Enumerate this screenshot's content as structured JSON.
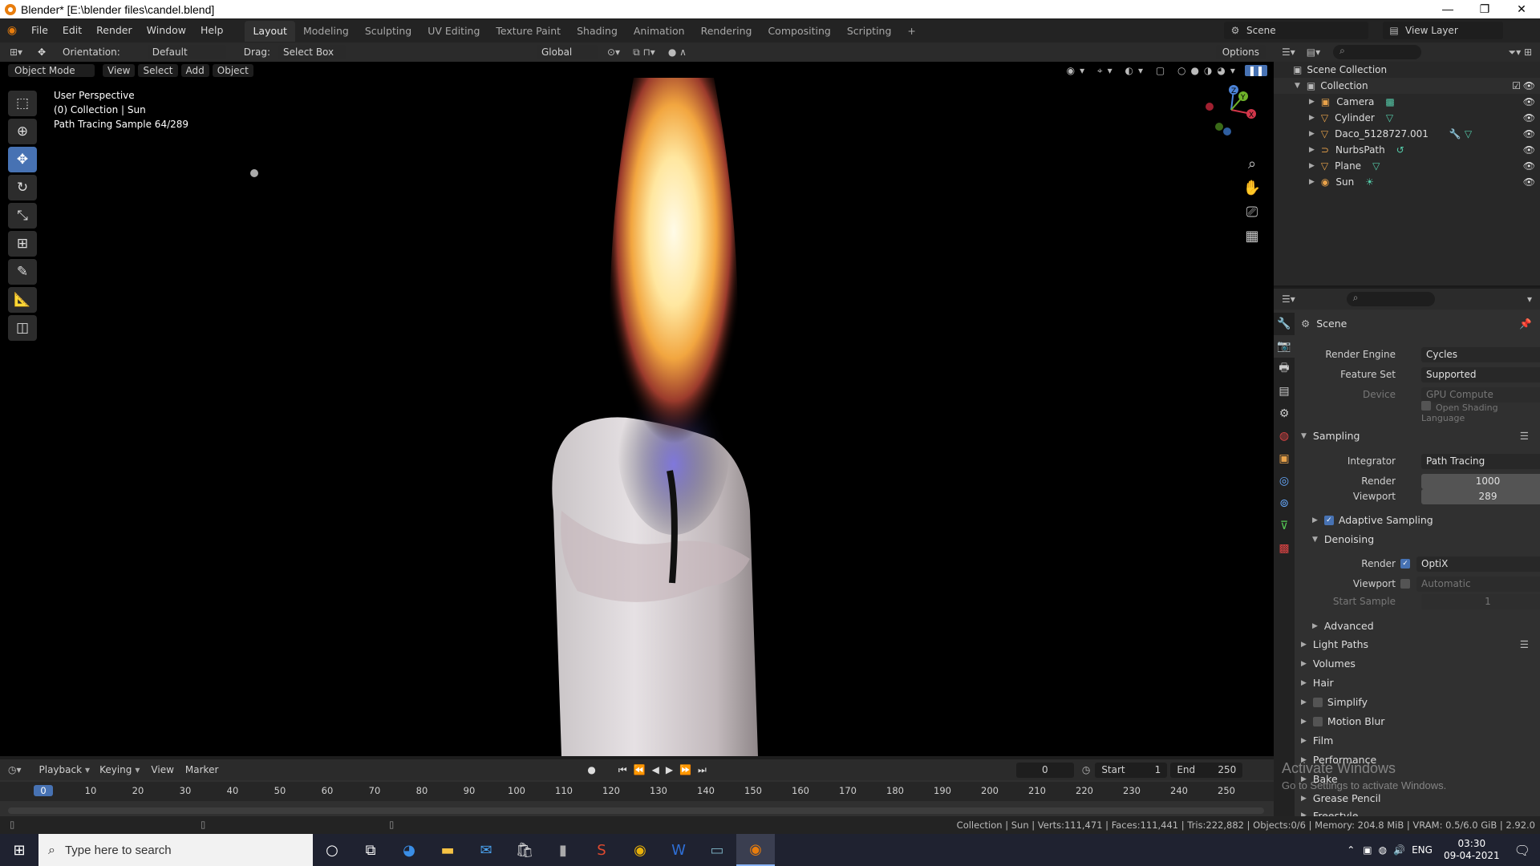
{
  "window": {
    "title": "Blender* [E:\\blender files\\candel.blend]",
    "min": "—",
    "max": "❐",
    "close": "✕"
  },
  "menu": [
    "File",
    "Edit",
    "Render",
    "Window",
    "Help"
  ],
  "workspaces": [
    "Layout",
    "Modeling",
    "Sculpting",
    "UV Editing",
    "Texture Paint",
    "Shading",
    "Animation",
    "Rendering",
    "Compositing",
    "Scripting"
  ],
  "active_workspace": "Layout",
  "scene": {
    "label": "Scene",
    "view_layer": "View Layer"
  },
  "tool_header": {
    "orientation_label": "Orientation:",
    "orientation_value": "Default",
    "drag_label": "Drag:",
    "drag_value": "Select Box",
    "transform": "Global",
    "options": "Options"
  },
  "viewport_header": {
    "mode": "Object Mode",
    "menus": [
      "View",
      "Select",
      "Add",
      "Object"
    ]
  },
  "viewport_info": {
    "line1": "User Perspective",
    "line2": "(0) Collection | Sun",
    "line3": "Path Tracing Sample 64/289"
  },
  "gizmo": {
    "x": "X",
    "y": "Y",
    "z": "Z"
  },
  "outliner": {
    "root": "Scene Collection",
    "collection": "Collection",
    "items": [
      {
        "name": "Camera",
        "icon": "camera-icon",
        "color": "#e8a24a"
      },
      {
        "name": "Cylinder",
        "icon": "mesh-icon",
        "color": "#e8a24a"
      },
      {
        "name": "Daco_5128727.001",
        "icon": "mesh-icon",
        "color": "#e8a24a"
      },
      {
        "name": "NurbsPath",
        "icon": "curve-icon",
        "color": "#e8a24a"
      },
      {
        "name": "Plane",
        "icon": "mesh-icon",
        "color": "#e8a24a"
      },
      {
        "name": "Sun",
        "icon": "light-icon",
        "color": "#e8a24a"
      }
    ]
  },
  "properties": {
    "context": "Scene",
    "render_engine_label": "Render Engine",
    "render_engine": "Cycles",
    "feature_set_label": "Feature Set",
    "feature_set": "Supported",
    "device_label": "Device",
    "device": "GPU Compute",
    "osl": "Open Shading Language",
    "sampling": "Sampling",
    "integrator_label": "Integrator",
    "integrator": "Path Tracing",
    "render_label": "Render",
    "render_samples": "1000",
    "viewport_label": "Viewport",
    "viewport_samples": "289",
    "adaptive": "Adaptive Sampling",
    "denoising": "Denoising",
    "den_render_label": "Render",
    "den_render": "OptiX",
    "den_viewport_label": "Viewport",
    "den_viewport": "Automatic",
    "start_sample_label": "Start Sample",
    "start_sample": "1",
    "advanced": "Advanced",
    "sections": [
      "Light Paths",
      "Volumes",
      "Hair",
      "Simplify",
      "Motion Blur",
      "Film",
      "Performance",
      "Bake",
      "Grease Pencil",
      "Freestyle"
    ]
  },
  "timeline": {
    "menus": [
      "Playback",
      "Keying",
      "View",
      "Marker"
    ],
    "current": "0",
    "start_label": "Start",
    "start": "1",
    "end_label": "End",
    "end": "250",
    "ticks": [
      "0",
      "10",
      "20",
      "30",
      "40",
      "50",
      "60",
      "70",
      "80",
      "90",
      "100",
      "110",
      "120",
      "130",
      "140",
      "150",
      "160",
      "170",
      "180",
      "190",
      "200",
      "210",
      "220",
      "230",
      "240",
      "250"
    ]
  },
  "watermark": {
    "line1": "Activate Windows",
    "line2": "Go to Settings to activate Windows."
  },
  "status": "Collection | Sun | Verts:111,471 | Faces:111,441 | Tris:222,882 | Objects:0/6 | Memory: 204.8 MiB | VRAM: 0.5/6.0 GiB | 2.92.0",
  "taskbar": {
    "search": "Type here to search",
    "lang": "ENG",
    "time": "03:30",
    "date": "09-04-2021"
  }
}
